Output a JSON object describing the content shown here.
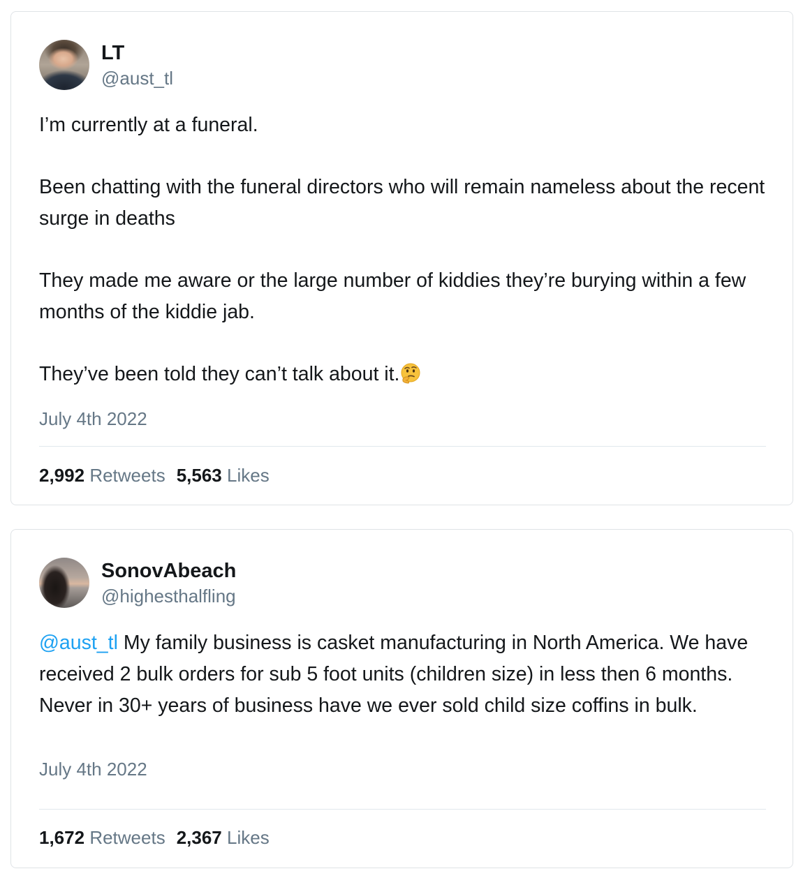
{
  "tweets": [
    {
      "user": {
        "display_name": "LT",
        "handle": "@aust_tl"
      },
      "paragraphs": [
        "I’m currently at a funeral.",
        "Been chatting with the funeral directors who will remain nameless about the recent surge in deaths",
        "They made me aware or the large number of kiddies they’re burying within a few months of the kiddie jab.",
        "They’ve been told they can’t talk about it."
      ],
      "trailing_emoji": "thinking-face-icon",
      "date": "July 4th 2022",
      "retweets_count": "2,992",
      "retweets_label": "Retweets",
      "likes_count": "5,563",
      "likes_label": "Likes"
    },
    {
      "user": {
        "display_name": "SonovAbeach",
        "handle": "@highesthalfling"
      },
      "mention": "@aust_tl",
      "body": " My family business is casket manufacturing in North America. We have received 2 bulk orders for sub 5 foot units (children size) in less then 6 months. Never in 30+ years of business have we ever sold child size coffins in bulk.",
      "date": "July 4th 2022",
      "retweets_count": "1,672",
      "retweets_label": "Retweets",
      "likes_count": "2,367",
      "likes_label": "Likes"
    }
  ],
  "colors": {
    "text": "#14171a",
    "secondary_text": "#657786",
    "mention": "#1da1f2",
    "border": "#dfe3e6"
  }
}
